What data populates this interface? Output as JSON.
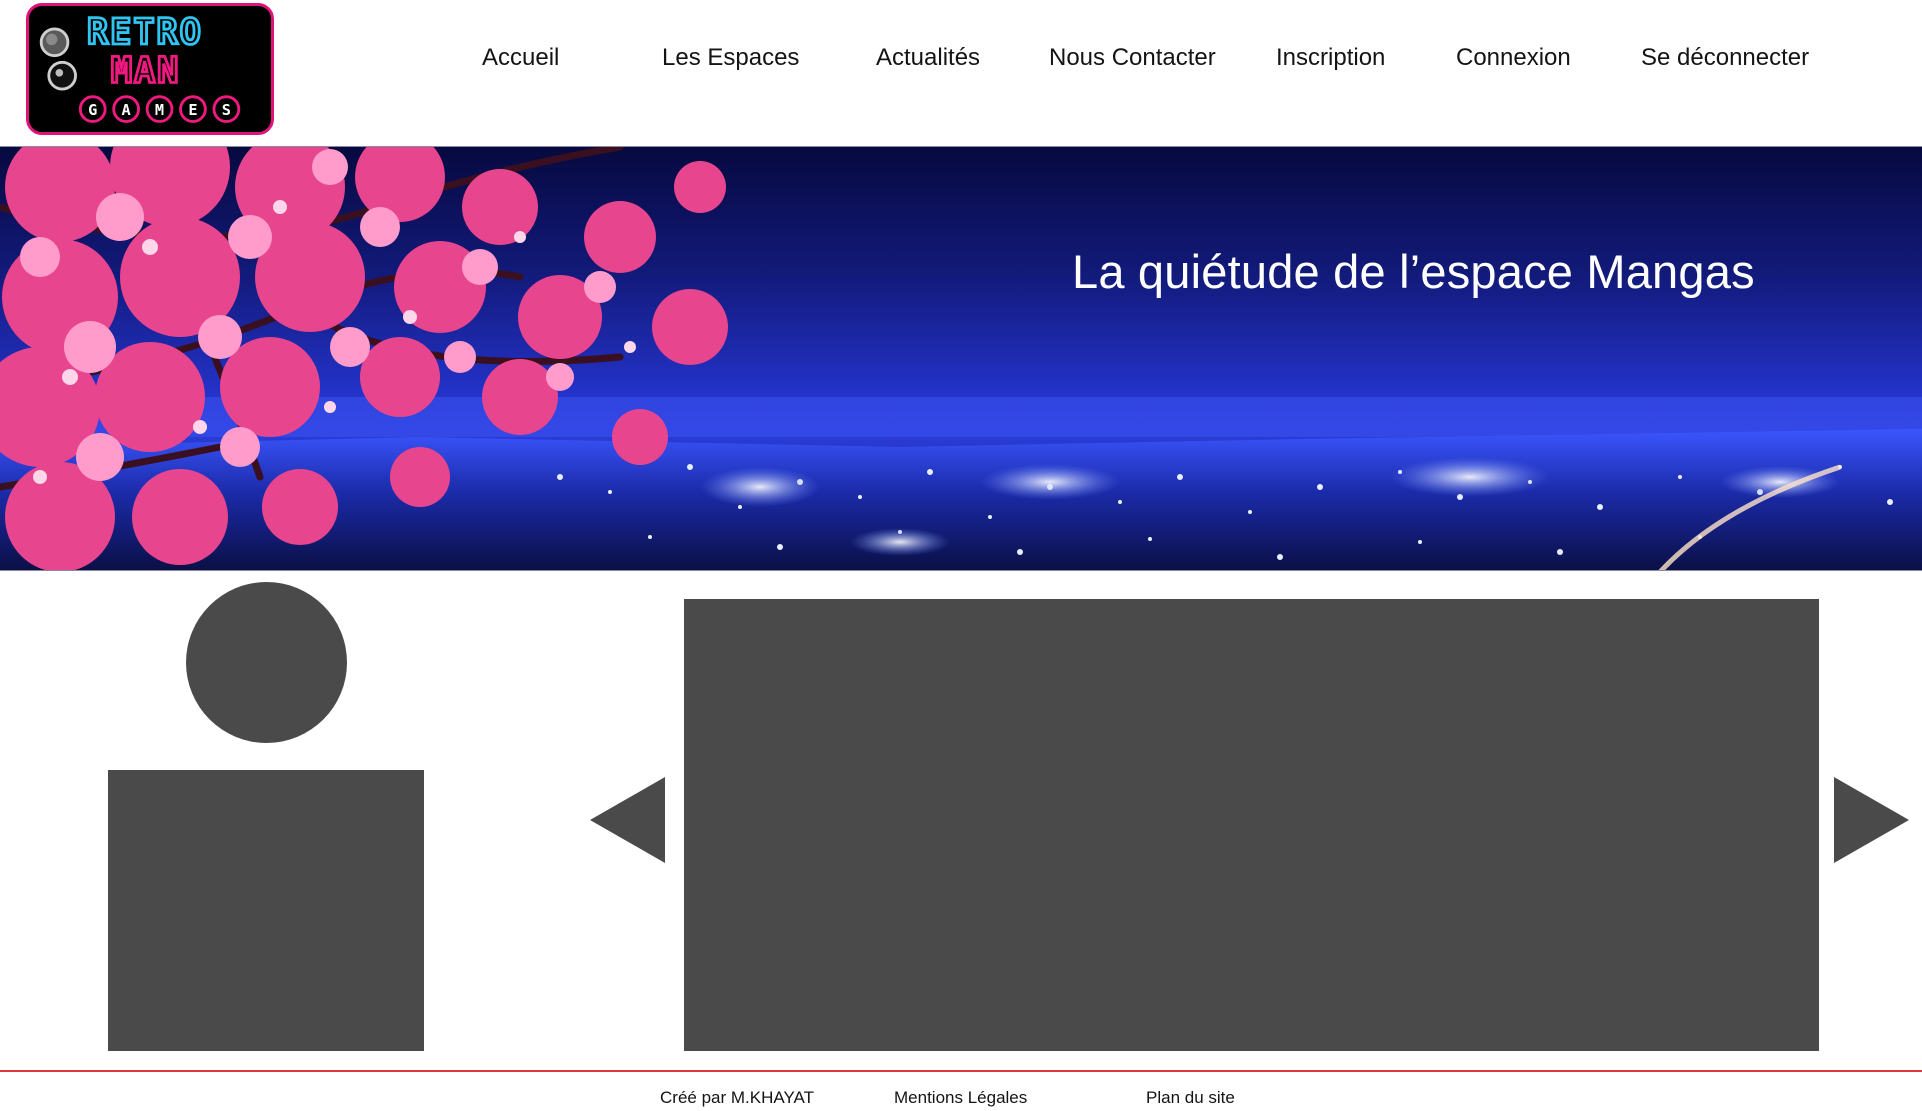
{
  "logo": {
    "line1": "RETRO",
    "line2": "MAN",
    "games_letters": [
      "G",
      "A",
      "M",
      "E",
      "S"
    ]
  },
  "nav": {
    "items": [
      {
        "label": "Accueil"
      },
      {
        "label": "Les Espaces"
      },
      {
        "label": "Actualités"
      },
      {
        "label": "Nous Contacter"
      },
      {
        "label": "Inscription"
      },
      {
        "label": "Connexion"
      },
      {
        "label": "Se déconnecter"
      }
    ]
  },
  "banner": {
    "title": "La quiétude de l’espace Mangas"
  },
  "footer": {
    "credit": "Créé par M.KHAYAT",
    "legal": "Mentions Légales",
    "sitemap": "Plan du site"
  },
  "colors": {
    "logo_blue": "#2fc4f2",
    "logo_pink": "#f0197f",
    "placeholder": "#4a4a4a",
    "footer_line": "#e0363c",
    "sky_dark": "#07093f",
    "sky_light": "#2a3ddc",
    "blossom": "#e8458f"
  },
  "icons": {
    "carousel_prev": "triangle-left-icon",
    "carousel_next": "triangle-right-icon",
    "avatar": "user-placeholder-icon"
  }
}
